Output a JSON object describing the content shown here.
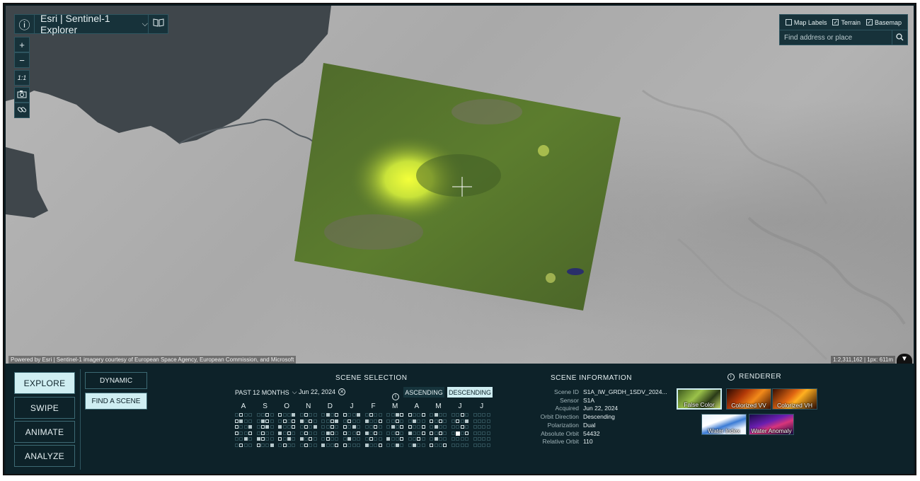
{
  "app": {
    "title": "Esri | Sentinel-1 Explorer"
  },
  "map": {
    "zoom_in": "+",
    "zoom_out": "−",
    "zoom_ratio": "1:1",
    "layers": {
      "map_labels": "Map Labels",
      "map_labels_checked": false,
      "terrain": "Terrain",
      "terrain_checked": true,
      "basemap": "Basemap",
      "basemap_checked": true
    },
    "search_placeholder": "Find address or place",
    "attribution": "Powered by Esri | Sentinel-1 imagery courtesy of European Space Agency, European Commission, and Microsoft",
    "scale": "1:2,311,162 | 1px: 611m"
  },
  "modes": {
    "explore": "EXPLORE",
    "swipe": "SWIPE",
    "animate": "ANIMATE",
    "analyze": "ANALYZE"
  },
  "submodes": {
    "dynamic": "DYNAMIC",
    "find_scene": "FIND A SCENE"
  },
  "scene_selection": {
    "title": "SCENE SELECTION",
    "period": "PAST 12 MONTHS",
    "selected_date": "Jun 22, 2024",
    "ascending": "ASCENDING",
    "descending": "DESCENDING",
    "months": [
      "A",
      "S",
      "O",
      "N",
      "D",
      "J",
      "F",
      "M",
      "A",
      "M",
      "J",
      "J"
    ]
  },
  "scene_info": {
    "title": "SCENE INFORMATION",
    "rows": [
      {
        "k": "Scene ID",
        "v": "S1A_IW_GRDH_1SDV_2024..."
      },
      {
        "k": "Sensor",
        "v": "S1A"
      },
      {
        "k": "Acquired",
        "v": "Jun 22, 2024"
      },
      {
        "k": "Orbit Direction",
        "v": "Descending"
      },
      {
        "k": "Polarization",
        "v": "Dual"
      },
      {
        "k": "Absolute Orbit",
        "v": "54432"
      },
      {
        "k": "Relative Orbit",
        "v": "110"
      }
    ]
  },
  "renderer": {
    "title": "RENDERER",
    "items": [
      {
        "label": "False Color"
      },
      {
        "label": "Colorized VV"
      },
      {
        "label": "Colorized VH"
      },
      {
        "label": "Water Index"
      },
      {
        "label": "Water Anomaly"
      }
    ]
  },
  "colors": {
    "panel_bg": "#0d2229",
    "active_button": "#cfeef2",
    "control_bg": "#17323a"
  }
}
